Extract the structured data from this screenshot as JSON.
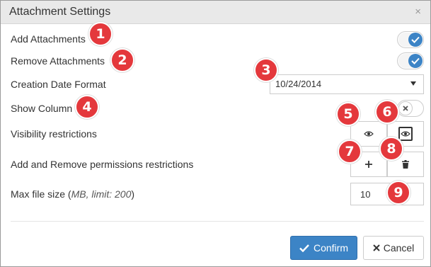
{
  "dialog": {
    "title": "Attachment Settings",
    "close_symbol": "×"
  },
  "rows": {
    "add_attachments": {
      "label": "Add Attachments",
      "enabled": true
    },
    "remove_attachments": {
      "label": "Remove Attachments",
      "enabled": true
    },
    "creation_date_format": {
      "label": "Creation Date Format",
      "value": "10/24/2014"
    },
    "show_column": {
      "label": "Show Column",
      "enabled": false
    },
    "visibility_restrictions": {
      "label": "Visibility restrictions"
    },
    "permissions_restrictions": {
      "label": "Add and Remove permissions restrictions"
    },
    "max_file_size": {
      "label_prefix": "Max file size (",
      "label_hint": "MB, limit: 200",
      "label_suffix": ")",
      "value": "10"
    }
  },
  "footer": {
    "confirm_label": "Confirm",
    "cancel_label": "Cancel"
  },
  "markers": [
    "1",
    "2",
    "3",
    "4",
    "5",
    "6",
    "7",
    "8",
    "9"
  ],
  "colors": {
    "accent": "#3c84c6",
    "marker": "#e4383c",
    "header_bg": "#e9e9e9"
  }
}
